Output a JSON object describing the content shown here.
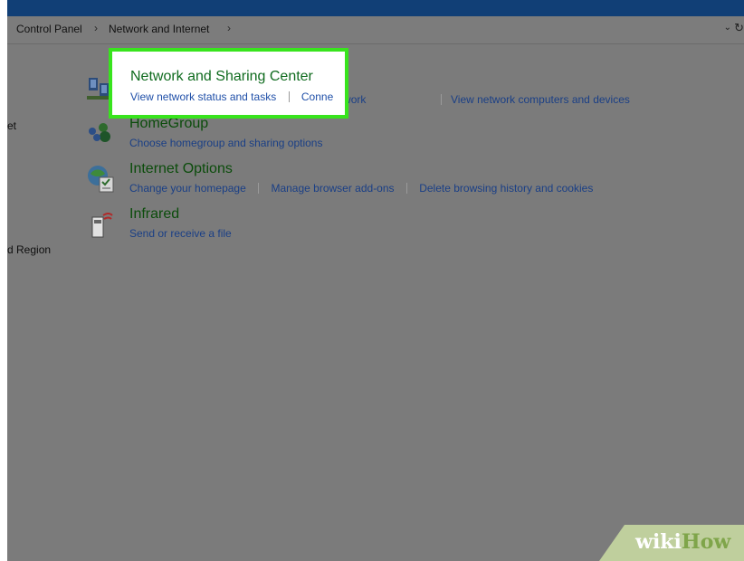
{
  "breadcrumb": {
    "items": [
      "Control Panel",
      "Network and Internet"
    ],
    "separator": "›",
    "dropdown_icon": "chevron-down-icon",
    "refresh_icon": "refresh-icon"
  },
  "left_nav": {
    "items": [
      "et",
      "d Region"
    ]
  },
  "items": [
    {
      "title": "Network and Sharing Center",
      "icon": "network-sharing-center-icon",
      "links": [
        "View network status and tasks",
        "Connect to a network",
        "View network computers and devices"
      ]
    },
    {
      "title": "HomeGroup",
      "icon": "homegroup-icon",
      "links": [
        "Choose homegroup and sharing options"
      ]
    },
    {
      "title": "Internet Options",
      "icon": "internet-options-icon",
      "links": [
        "Change your homepage",
        "Manage browser add-ons",
        "Delete browsing history and cookies"
      ]
    },
    {
      "title": "Infrared",
      "icon": "infrared-icon",
      "links": [
        "Send or receive a file"
      ]
    }
  ],
  "highlight": {
    "title": "Network and Sharing Center",
    "link1": "View network status and tasks",
    "link2_partial": "Conne",
    "color": "#38e41d"
  },
  "overlay_right": {
    "link2_rest": "to a network"
  },
  "watermark": {
    "wiki": "wiki",
    "how": "How"
  }
}
